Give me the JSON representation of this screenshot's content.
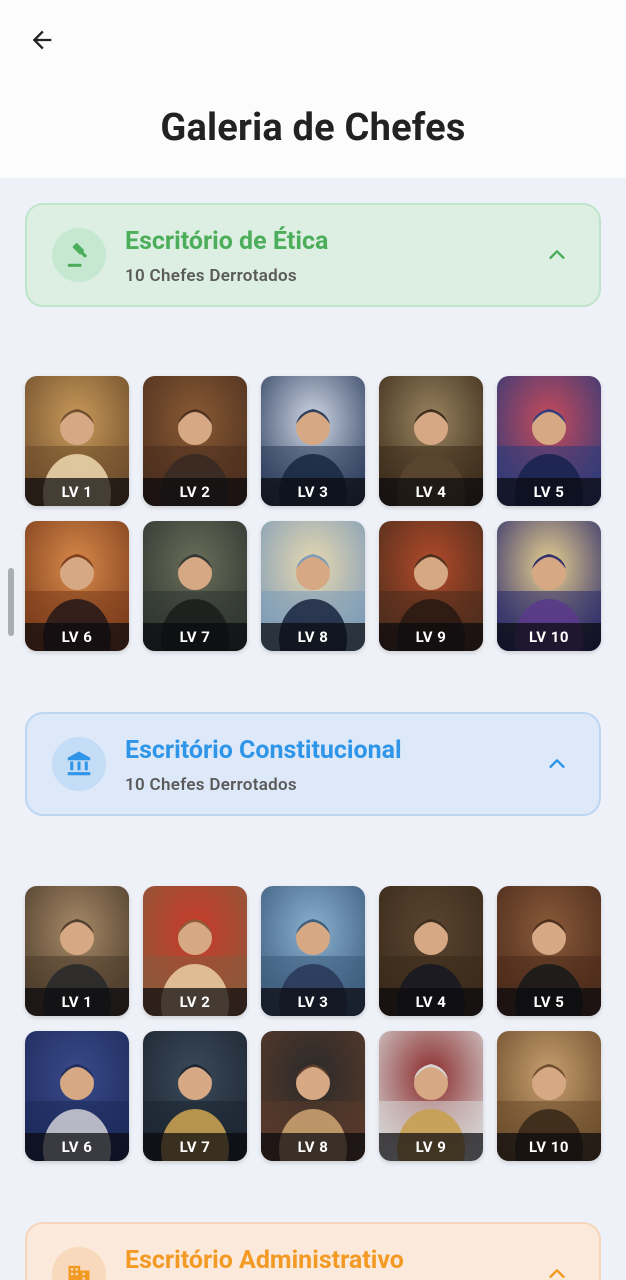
{
  "header": {
    "title": "Galeria de Chefes",
    "back_icon": "arrow-left-icon"
  },
  "sections": [
    {
      "title": "Escritório de Ética",
      "subtitle": "10 Chefes Derrotados",
      "icon": "gavel-icon",
      "accent": "#4cae5b",
      "expanded": true,
      "bosses": [
        {
          "level": "LV 1",
          "palette": [
            "#6b4a2a",
            "#c99a5a",
            "#e8d2a8"
          ]
        },
        {
          "level": "LV 2",
          "palette": [
            "#4a2e1e",
            "#8a5a34",
            "#3a2a22"
          ]
        },
        {
          "level": "LV 3",
          "palette": [
            "#2a3a5a",
            "#cfd8e6",
            "#1c2a44"
          ]
        },
        {
          "level": "LV 4",
          "palette": [
            "#3a2a1a",
            "#9a8460",
            "#5a4630"
          ]
        },
        {
          "level": "LV 5",
          "palette": [
            "#2a3a7a",
            "#c94a5a",
            "#1a2450"
          ]
        },
        {
          "level": "LV 6",
          "palette": [
            "#7a3a1a",
            "#d88a4a",
            "#2a1a1a"
          ]
        },
        {
          "level": "LV 7",
          "palette": [
            "#2e3430",
            "#6a6e5a",
            "#1c1e1c"
          ]
        },
        {
          "level": "LV 8",
          "palette": [
            "#7a9ab8",
            "#e8d8b0",
            "#1e2a44"
          ]
        },
        {
          "level": "LV 9",
          "palette": [
            "#4a2c1c",
            "#b24a2a",
            "#2a1a12"
          ]
        },
        {
          "level": "LV 10",
          "palette": [
            "#2a2a6a",
            "#e8d090",
            "#5a3a8a"
          ]
        }
      ]
    },
    {
      "title": "Escritório Constitucional",
      "subtitle": "10 Chefes Derrotados",
      "icon": "bank-building-icon",
      "accent": "#2f95e8",
      "expanded": true,
      "bosses": [
        {
          "level": "LV 1",
          "palette": [
            "#4a3a2a",
            "#a88a68",
            "#2a2a2a"
          ]
        },
        {
          "level": "LV 2",
          "palette": [
            "#8a5a3a",
            "#c83a2a",
            "#e8c8a0"
          ]
        },
        {
          "level": "LV 3",
          "palette": [
            "#3a5a7a",
            "#8ab0d0",
            "#2a3a5a"
          ]
        },
        {
          "level": "LV 4",
          "palette": [
            "#3a2a1a",
            "#5a4430",
            "#1a1a22"
          ]
        },
        {
          "level": "LV 5",
          "palette": [
            "#4a2a1a",
            "#8a5a3a",
            "#1a1a1a"
          ]
        },
        {
          "level": "LV 6",
          "palette": [
            "#1c2a5a",
            "#3a4a8a",
            "#c8c8d0"
          ]
        },
        {
          "level": "LV 7",
          "palette": [
            "#1c2430",
            "#3a4a5a",
            "#c8a050"
          ]
        },
        {
          "level": "LV 8",
          "palette": [
            "#5a3a2a",
            "#2a2a2a",
            "#c8a070"
          ]
        },
        {
          "level": "LV 9",
          "palette": [
            "#d8d8d8",
            "#8a2a2a",
            "#c8a050"
          ]
        },
        {
          "level": "LV 10",
          "palette": [
            "#6a4a2a",
            "#c8a070",
            "#3a2a1a"
          ]
        }
      ]
    },
    {
      "title": "Escritório Administrativo",
      "subtitle": "",
      "icon": "office-building-icon",
      "accent": "#f39a25",
      "expanded": true,
      "bosses": []
    }
  ]
}
